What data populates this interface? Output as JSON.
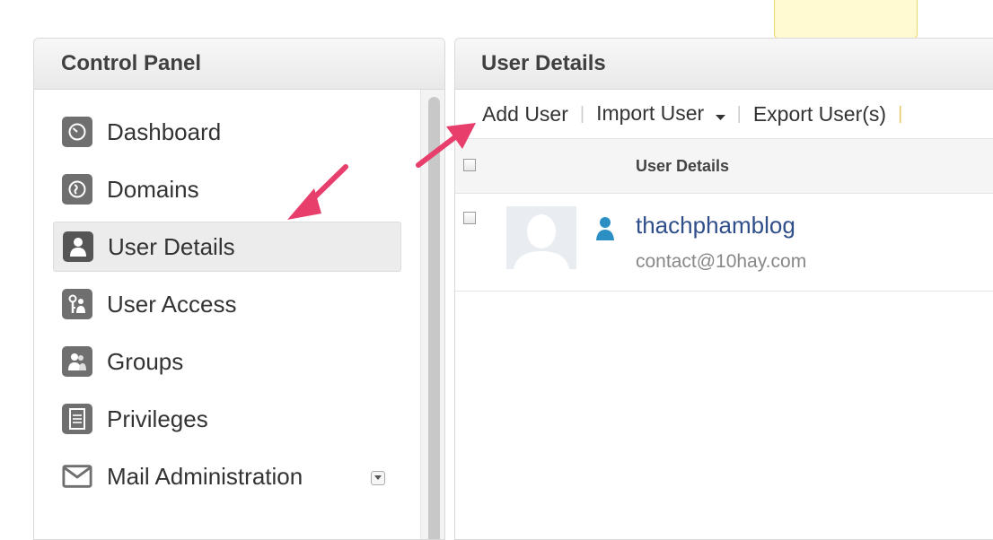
{
  "control_panel": {
    "title": "Control Panel",
    "nav": [
      {
        "label": "Dashboard",
        "icon": "dashboard-icon",
        "active": false
      },
      {
        "label": "Domains",
        "icon": "globe-icon",
        "active": false
      },
      {
        "label": "User Details",
        "icon": "user-icon",
        "active": true
      },
      {
        "label": "User Access",
        "icon": "key-icon",
        "active": false
      },
      {
        "label": "Groups",
        "icon": "groups-icon",
        "active": false
      },
      {
        "label": "Privileges",
        "icon": "document-icon",
        "active": false
      },
      {
        "label": "Mail Administration",
        "icon": "mail-icon",
        "active": false
      }
    ]
  },
  "user_details": {
    "title": "User Details",
    "toolbar": {
      "add_user": "Add User",
      "import_user": "Import User",
      "export_users": "Export User(s)"
    },
    "table": {
      "column_header": "User Details",
      "rows": [
        {
          "name": "thachphamblog",
          "email": "contact@10hay.com"
        }
      ]
    }
  },
  "colors": {
    "annotation_arrow": "#e83e6c",
    "link": "#2f4e8a",
    "user_icon": "#2b8fc4"
  }
}
